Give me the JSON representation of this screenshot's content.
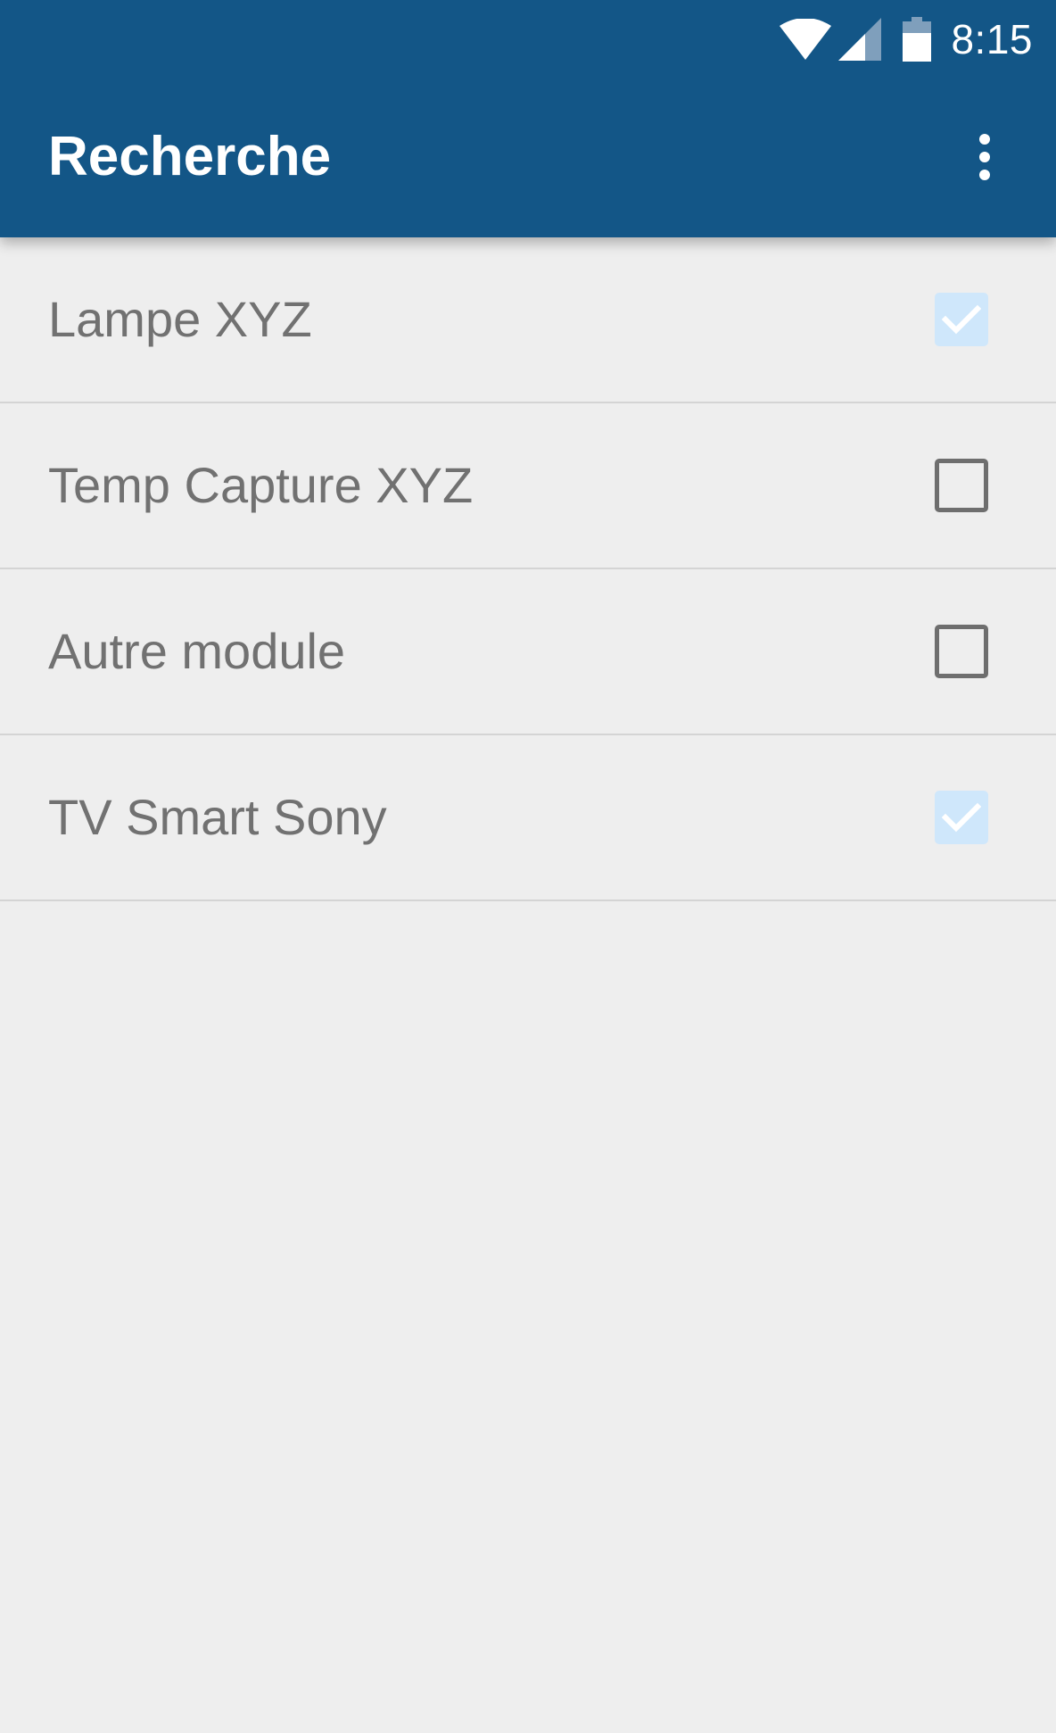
{
  "status_bar": {
    "time": "8:15",
    "icons": [
      "wifi-icon",
      "cell-signal-icon",
      "battery-icon"
    ]
  },
  "toolbar": {
    "title": "Recherche",
    "overflow_icon": "more-vert-icon"
  },
  "devices": [
    {
      "label": "Lampe XYZ",
      "checked": true
    },
    {
      "label": "Temp Capture XYZ",
      "checked": false
    },
    {
      "label": "Autre module",
      "checked": false
    },
    {
      "label": "TV Smart Sony",
      "checked": true
    }
  ],
  "colors": {
    "app_bar": "#135687",
    "background": "#eeeeee",
    "row_text": "#717171",
    "checked_fill": "#cfe7fb",
    "check_mark": "#ffffff",
    "unchecked_border": "#6e6e6e"
  }
}
